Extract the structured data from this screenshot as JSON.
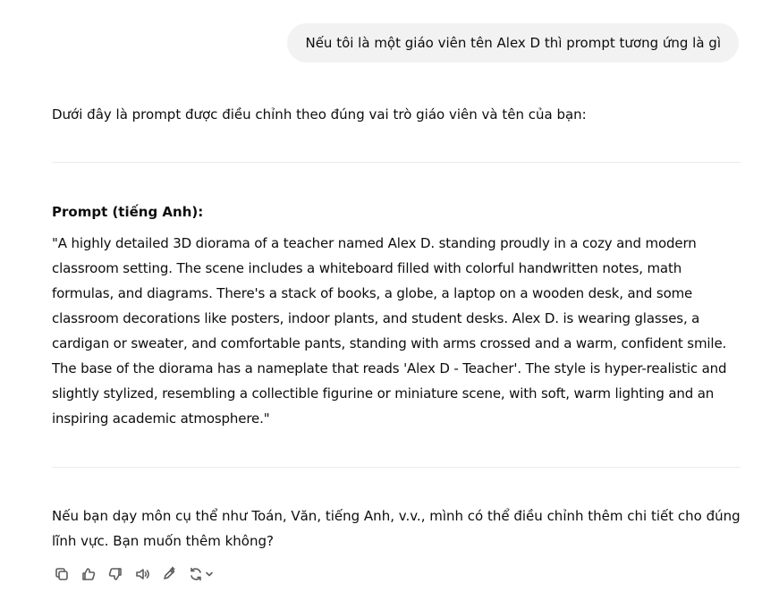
{
  "user_message": "Nếu tôi là một giáo viên tên Alex D thì prompt tương ứng là gì",
  "assistant": {
    "intro": "Dưới đây là prompt được điều chỉnh theo đúng vai trò giáo viên và tên của bạn:",
    "prompt_heading": "Prompt (tiếng Anh):",
    "prompt_text": "\"A highly detailed 3D diorama of a teacher named Alex D. standing proudly in a cozy and modern classroom setting. The scene includes a whiteboard filled with colorful handwritten notes, math formulas, and diagrams. There's a stack of books, a globe, a laptop on a wooden desk, and some classroom decorations like posters, indoor plants, and student desks. Alex D. is wearing glasses, a cardigan or sweater, and comfortable pants, standing with arms crossed and a warm, confident smile. The base of the diorama has a nameplate that reads 'Alex D - Teacher'. The style is hyper-realistic and slightly stylized, resembling a collectible figurine or miniature scene, with soft, warm lighting and an inspiring academic atmosphere.\"",
    "followup": "Nếu bạn dạy môn cụ thể như Toán, Văn, tiếng Anh, v.v., mình có thể điều chỉnh thêm chi tiết cho đúng lĩnh vực. Bạn muốn thêm không?"
  },
  "toolbar": {
    "icons": [
      "copy-icon",
      "thumbs-up-icon",
      "thumbs-down-icon",
      "read-aloud-icon",
      "edit-icon",
      "regenerate-icon"
    ]
  },
  "colors": {
    "bubble_bg": "#f2f2f2",
    "text": "#0d0d0d",
    "icon": "#5d5d5d",
    "divider": "#ececec"
  }
}
